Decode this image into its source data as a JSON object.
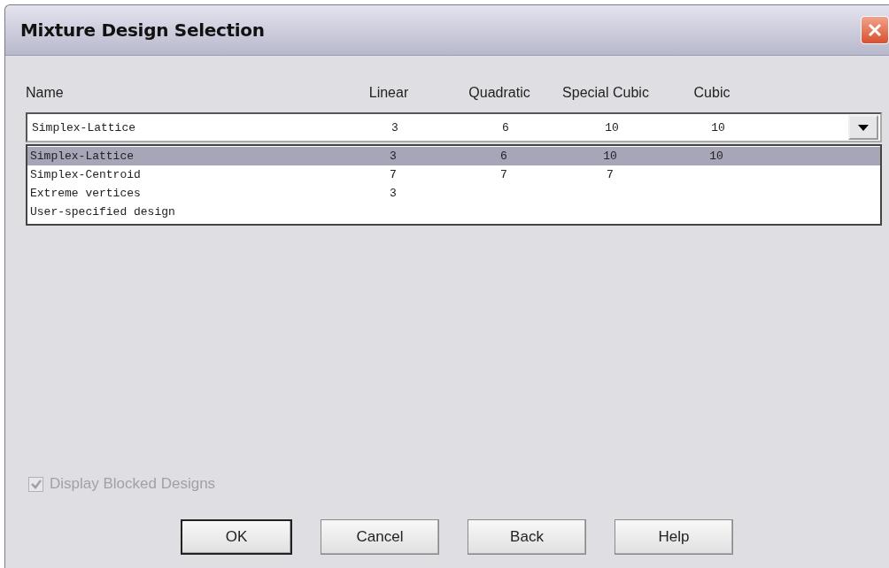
{
  "window": {
    "title": "Mixture Design Selection"
  },
  "columns": [
    "Name",
    "Linear",
    "Quadratic",
    "Special Cubic",
    "Cubic"
  ],
  "combo": {
    "value": [
      "Simplex-Lattice",
      "3",
      "6",
      "10",
      "10"
    ]
  },
  "list": [
    {
      "cells": [
        "Simplex-Lattice",
        "3",
        "6",
        "10",
        "10"
      ],
      "selected": true
    },
    {
      "cells": [
        "Simplex-Centroid",
        "7",
        "7",
        "7",
        ""
      ],
      "selected": false
    },
    {
      "cells": [
        "Extreme vertices",
        "3",
        "",
        "",
        ""
      ],
      "selected": false
    },
    {
      "cells": [
        "User-specified design",
        "",
        "",
        "",
        ""
      ],
      "selected": false
    }
  ],
  "checkbox": {
    "label": "Display Blocked Designs",
    "checked": true,
    "disabled": true
  },
  "buttons": [
    {
      "label": "OK",
      "default": true
    },
    {
      "label": "Cancel",
      "default": false
    },
    {
      "label": "Back",
      "default": false
    },
    {
      "label": "Help",
      "default": false
    }
  ]
}
